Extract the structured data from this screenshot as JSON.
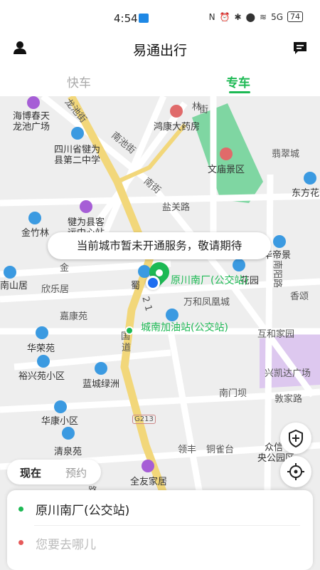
{
  "status": {
    "time": "4:54",
    "battery": "74",
    "signal": "5G"
  },
  "header": {
    "title": "易通出行"
  },
  "tabs": [
    {
      "label": "快车"
    },
    {
      "label": "专车"
    }
  ],
  "map": {
    "tooltip": "当前城市暂未开通服务，敬请期待",
    "pickup_label": "原川南厂(公交站)",
    "gas_label": "城南加油站(公交站)",
    "labels": {
      "longchi_street": "龙池街",
      "hbct": "海博春天",
      "lcgc": "龙池广场",
      "school1": "四川省犍为",
      "school2": "县第二中学",
      "nanchi": "南池街",
      "pharmacy": "鸿康大药房",
      "fengcui": "翡翠城",
      "wenmiao": "文庙景区",
      "nanjie": "南街",
      "dongfang": "东方花",
      "yanguan": "盐关路",
      "busstop1": "犍为县客",
      "busstop2": "运中心站",
      "jinzhu": "金竹林",
      "jinhuan": "金",
      "huadi": "华帝景",
      "nanshan": "南山居",
      "xinle": "欣乐居",
      "shu": "蜀",
      "nanyang": "南阳路",
      "huayuan": "花园",
      "wanhe": "万和凤凰城",
      "xiangsong": "香颂",
      "jiakang": "嘉康苑",
      "road": "道",
      "road_num": "2 1",
      "guo": "国",
      "hujia": "互和家园",
      "huarong": "华荣苑",
      "xingkai": "兴凯达广场",
      "yuxing": "裕兴苑小区",
      "lancheng": "蓝城绿洲",
      "nanmen": "南门坝",
      "dunjia": "敦家路",
      "huakang": "华康小区",
      "g213": "G213",
      "qingquan": "清泉苑",
      "lingfeng": "领丰",
      "tongque": "铜雀台",
      "zhongxin": "众信",
      "yanggong": "央公园区",
      "quanyou": "全友家居",
      "lu": "路",
      "linjie": "林",
      "jie2": "街"
    }
  },
  "time_toggle": {
    "now": "现在",
    "book": "预约"
  },
  "trip": {
    "from": "原川南厂(公交站)",
    "to_placeholder": "您要去哪儿"
  },
  "colors": {
    "accent": "#1db954",
    "road": "#f2d77a",
    "park": "#7fd6a2",
    "block": "#e0e0e0"
  },
  "icons": [
    "user-icon",
    "message-icon",
    "shield-plus-icon",
    "target-icon",
    "pin-icon"
  ]
}
